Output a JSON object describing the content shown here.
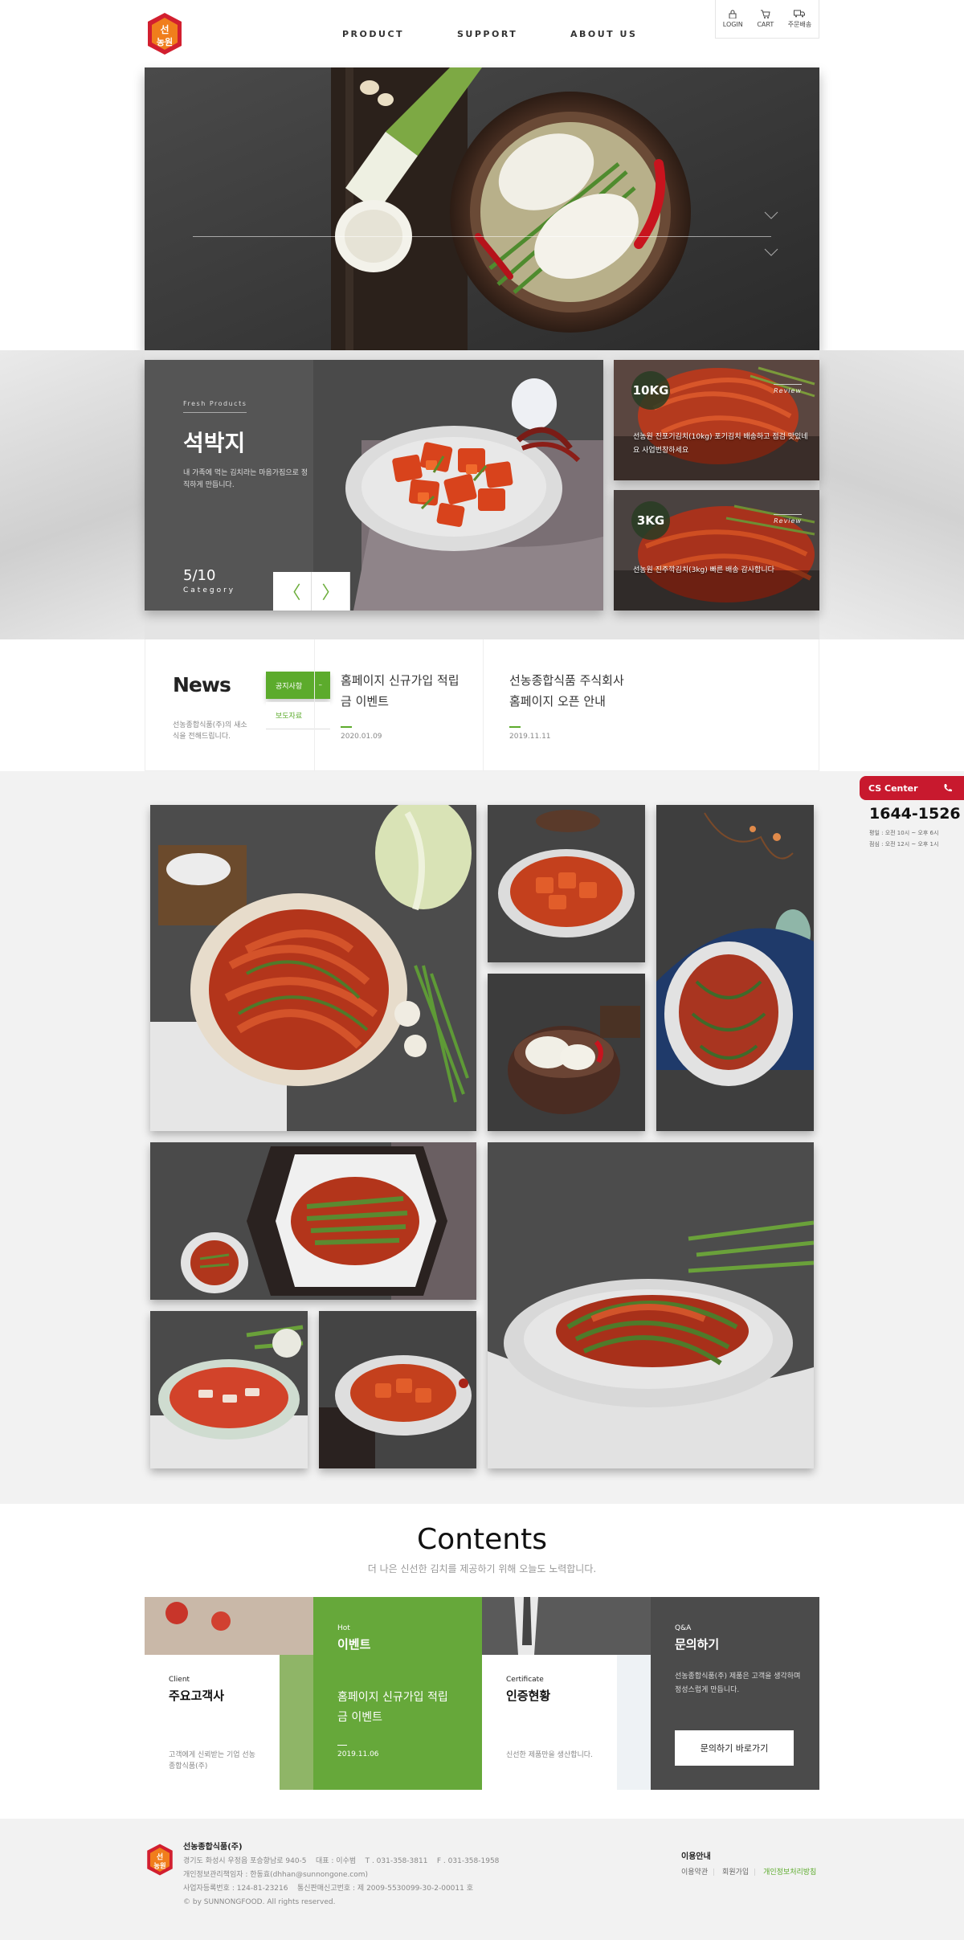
{
  "header": {
    "logo_text": "선농원",
    "nav": [
      "PRODUCT",
      "SUPPORT",
      "ABOUT US"
    ],
    "util": [
      "LOGIN",
      "CART",
      "주문배송"
    ]
  },
  "featured": {
    "tag": "Fresh Products",
    "title": "석박지",
    "description": "내 가족에 먹는 김치라는 마음가짐으로 정직하게 만듭니다.",
    "counter": "5/10",
    "category": "Category",
    "prev": "〈",
    "next": "〉"
  },
  "side_cards": [
    {
      "badge": "10KG",
      "review": "Review",
      "text": "선농원 진포기김치(10kg) 포기김치 배송하고 점검 맛있네요 사업번창하세요"
    },
    {
      "badge": "3KG",
      "review": "Review",
      "text": "선농원 진주깍김치(3kg) 빠른 배송 감사합니다"
    }
  ],
  "news": {
    "title": "News",
    "description": "선농종합식품(주)의 새소식을 전해드립니다.",
    "tabs": [
      "공지사항",
      "보도자료"
    ],
    "tab_arrow": "–",
    "items": [
      {
        "title": "홈페이지 신규가입 적립금 이벤트",
        "date": "2020.01.09"
      },
      {
        "title": "선농종합식품 주식회사 홈페이지 오픈 안내",
        "date": "2019.11.11"
      }
    ]
  },
  "cs_center": {
    "label": "CS Center",
    "phone": "1644-1526",
    "hours": [
      "평일 : 오전 10시 ~ 오후 6시",
      "점심 : 오전 12시 ~ 오후 1시"
    ]
  },
  "contents": {
    "title": "Contents",
    "subtitle": "더 나은 신선한 김치를 제공하기 위해 오늘도 노력합니다.",
    "client": {
      "small": "Client",
      "title": "주요고객사",
      "desc": "고객에게 신뢰받는 기업 선농종합식품(주)"
    },
    "event": {
      "small": "Hot",
      "title": "이벤트",
      "desc": "홈페이지 신규가입 적립금 이벤트",
      "date": "2019.11.06"
    },
    "cert": {
      "small": "Certificate",
      "title": "인증현황",
      "desc": "신선한 제품만을 생산합니다."
    },
    "qa": {
      "small": "Q&A",
      "title": "문의하기",
      "desc": "선농종합식품(주) 제품은 고객을 생각하며 정성스럽게 만듭니다.",
      "button": "문의하기 바로가기"
    }
  },
  "footer": {
    "company": "선농종합식품(주)",
    "address": "경기도 화성시 우정읍 포승향남로 940-5",
    "ceo": "대표 : 이수범",
    "tel": "T . 031-358-3811",
    "fax": "F . 031-358-1958",
    "privacy": "개인정보관리책임자 : 한동효(dhhan@sunnongone.com)",
    "business": "사업자등록번호 : 124-81-23216",
    "mail_order": "통신판매신고번호 : 제 2009-5530099-30-2-00011 호",
    "copyright": "© by SUNNONGFOOD. All rights reserved.",
    "links_title": "이용안내",
    "links": [
      "이용약관",
      "회원가입",
      "개인정보처리방침"
    ]
  },
  "colors": {
    "accent_green": "#5cab2c",
    "brand_red": "#c8192e"
  }
}
